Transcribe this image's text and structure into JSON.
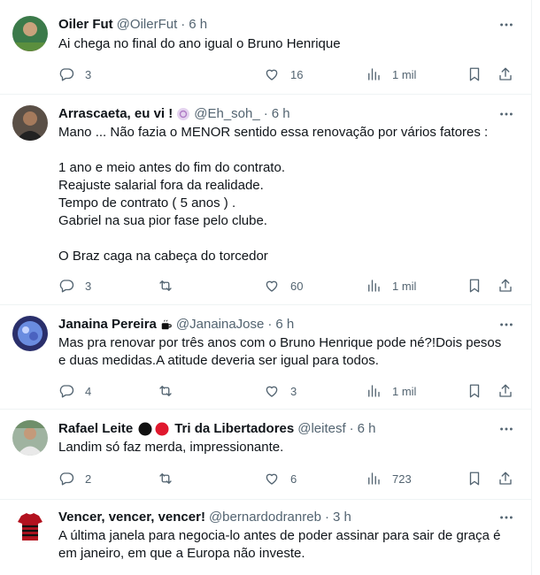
{
  "tweets": [
    {
      "name": "Oiler Fut",
      "handle": "@OilerFut",
      "time": "6 h",
      "text": "Ai chega no final do ano igual o Bruno Henrique",
      "replies": "3",
      "retweets": "",
      "likes": "16",
      "views": "1 mil"
    },
    {
      "name": "Arrascaeta, eu vi !",
      "handle": "@Eh_soh_",
      "time": "6 h",
      "text": "Mano ... Não fazia o MENOR sentido essa renovação por vários fatores :\n\n1 ano e meio antes do fim do contrato.\nReajuste salarial fora da realidade.\nTempo de contrato ( 5 anos ) .\nGabriel na sua pior fase pelo clube.\n\nO Braz caga na cabeça do torcedor",
      "replies": "3",
      "retweets": "",
      "likes": "60",
      "views": "1 mil"
    },
    {
      "name": "Janaina Pereira",
      "handle": "@JanainaJose",
      "time": "6 h",
      "text": "Mas pra renovar por três anos com o Bruno Henrique pode né?!Dois pesos\ne duas medidas.A atitude deveria ser igual para todos.",
      "replies": "4",
      "retweets": "",
      "likes": "3",
      "views": "1 mil"
    },
    {
      "name": "Rafael Leite",
      "name_suffix": "Tri da Libertadores",
      "handle": "@leitesf",
      "time": "6 h",
      "text": "Landim só faz merda, impressionante.",
      "replies": "2",
      "retweets": "",
      "likes": "6",
      "views": "723"
    },
    {
      "name": "Vencer, vencer, vencer!",
      "handle": "@bernardodranreb",
      "time": "3 h",
      "text": "A última janela para negocia-lo antes de poder assinar para sair de graça é\nem janeiro, em que a Europa não investe.",
      "replies": "",
      "retweets": "",
      "likes": "",
      "views": ""
    }
  ],
  "separator": "·",
  "icons": {
    "reply": "reply-icon",
    "retweet": "retweet-icon",
    "like": "heart-icon",
    "views": "views-icon",
    "bookmark": "bookmark-icon",
    "share": "share-icon",
    "more": "more-icon"
  },
  "colors": {
    "text": "#0f1419",
    "secondary": "#536471",
    "divider": "#eff3f4",
    "flamengo_red": "#e0182d",
    "black": "#111111"
  }
}
